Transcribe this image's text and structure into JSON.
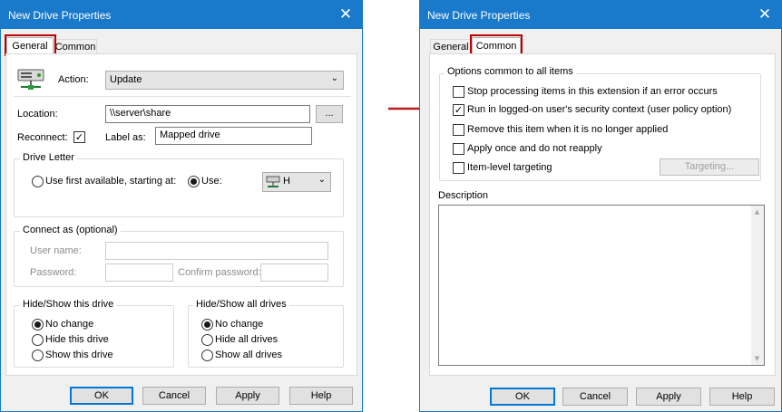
{
  "left_dialog": {
    "title": "New Drive Properties",
    "tabs": [
      {
        "label": "General",
        "active": true
      },
      {
        "label": "Common",
        "active": false
      }
    ],
    "action_label": "Action:",
    "action_value": "Update",
    "location_label": "Location:",
    "location_value": "\\\\server\\share",
    "browse_label": "...",
    "reconnect_label": "Reconnect:",
    "reconnect_checked": true,
    "label_as_label": "Label as:",
    "label_as_value": "Mapped drive",
    "drive_letter": {
      "title": "Drive Letter",
      "first_available_label": "Use first available, starting at:",
      "use_label": "Use:",
      "use_selected": true,
      "drive_value": "H"
    },
    "connect_as": {
      "title": "Connect as (optional)",
      "username_label": "User name:",
      "password_label": "Password:",
      "confirm_label": "Confirm password:"
    },
    "hide_show_this": {
      "title": "Hide/Show this drive",
      "options": [
        "No change",
        "Hide this drive",
        "Show this drive"
      ],
      "selected": 0
    },
    "hide_show_all": {
      "title": "Hide/Show all drives",
      "options": [
        "No change",
        "Hide all drives",
        "Show all drives"
      ],
      "selected": 0
    },
    "buttons": {
      "ok": "OK",
      "cancel": "Cancel",
      "apply": "Apply",
      "help": "Help"
    }
  },
  "right_dialog": {
    "title": "New Drive Properties",
    "tabs": [
      {
        "label": "General",
        "active": false
      },
      {
        "label": "Common",
        "active": true
      }
    ],
    "options_group_title": "Options common to all items",
    "options": [
      {
        "label": "Stop processing items in this extension if an error occurs",
        "checked": false
      },
      {
        "label": "Run in logged-on user's security context (user policy option)",
        "checked": true
      },
      {
        "label": "Remove this item when it is no longer applied",
        "checked": false
      },
      {
        "label": "Apply once and do not reapply",
        "checked": false
      },
      {
        "label": "Item-level targeting",
        "checked": false
      }
    ],
    "targeting_button": "Targeting...",
    "description_label": "Description",
    "buttons": {
      "ok": "OK",
      "cancel": "Cancel",
      "apply": "Apply",
      "help": "Help"
    }
  },
  "colors": {
    "titlebar": "#1979ca",
    "highlight": "#c00000",
    "arrow": "#b71c1c"
  },
  "icons": {
    "close": "close-icon",
    "drive": "network-drive-icon",
    "arrow": "red-arrow-icon"
  }
}
